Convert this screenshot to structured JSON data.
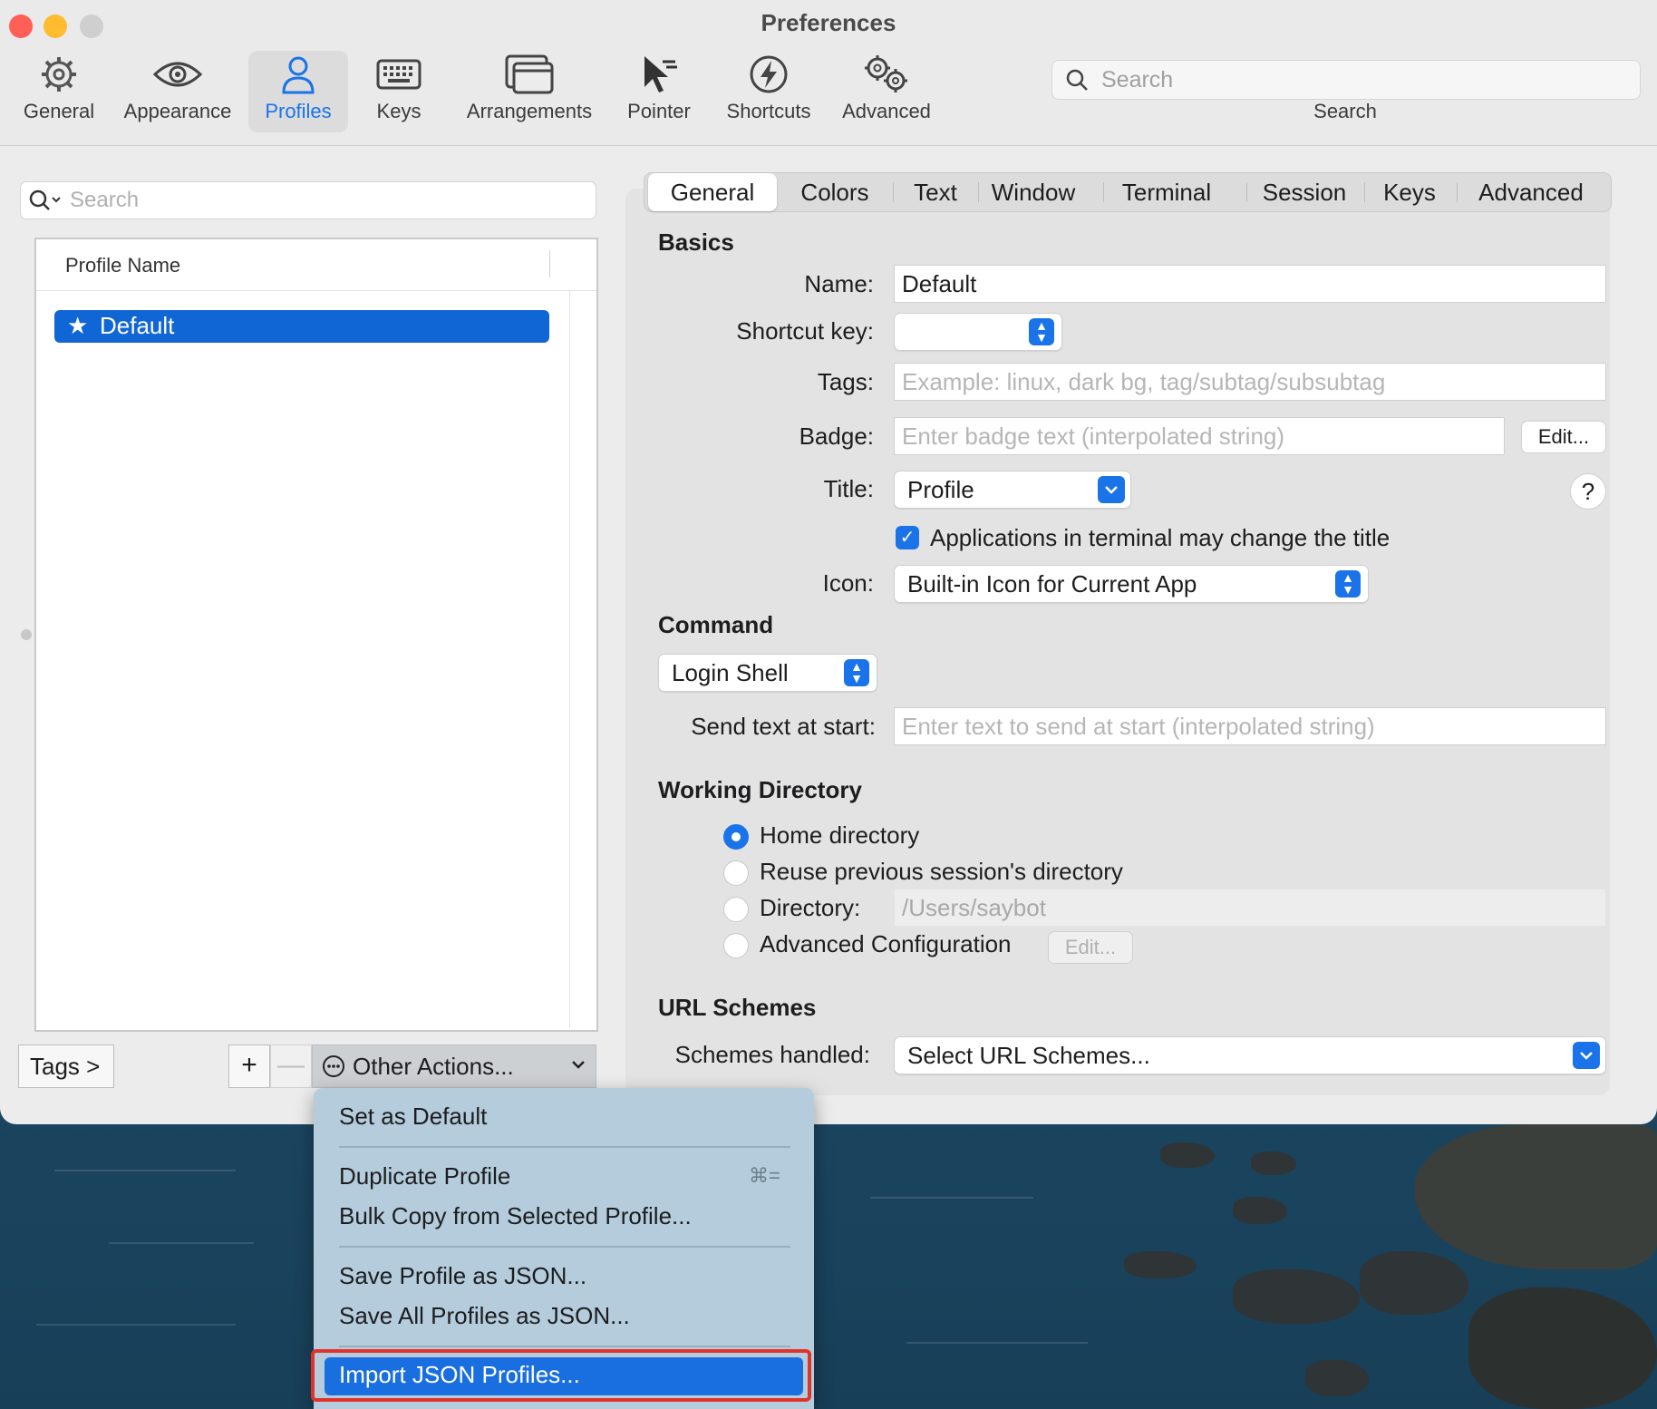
{
  "window": {
    "title": "Preferences"
  },
  "toolbar": {
    "items": [
      {
        "label": "General",
        "icon": "gear-icon"
      },
      {
        "label": "Appearance",
        "icon": "eye-icon"
      },
      {
        "label": "Profiles",
        "icon": "person-icon"
      },
      {
        "label": "Keys",
        "icon": "keyboard-icon"
      },
      {
        "label": "Arrangements",
        "icon": "windows-icon"
      },
      {
        "label": "Pointer",
        "icon": "cursor-icon"
      },
      {
        "label": "Shortcuts",
        "icon": "lightning-icon"
      },
      {
        "label": "Advanced",
        "icon": "gears-icon"
      }
    ],
    "active": "Profiles",
    "search_placeholder": "Search",
    "search_caption": "Search"
  },
  "profiles": {
    "search_placeholder": "Search",
    "column_header": "Profile Name",
    "rows": [
      {
        "name": "Default",
        "is_default": true,
        "selected": true
      }
    ],
    "tags_button": "Tags >",
    "add_button": "+",
    "remove_button": "—",
    "other_actions": "Other Actions..."
  },
  "tabs": {
    "items": [
      "General",
      "Colors",
      "Text",
      "Window",
      "Terminal",
      "Session",
      "Keys",
      "Advanced"
    ],
    "active": "General"
  },
  "basics": {
    "section": "Basics",
    "name_label": "Name:",
    "name_value": "Default",
    "shortcut_label": "Shortcut key:",
    "tags_label": "Tags:",
    "tags_placeholder": "Example: linux, dark bg, tag/subtag/subsubtag",
    "badge_label": "Badge:",
    "badge_placeholder": "Enter badge text (interpolated string)",
    "badge_edit": "Edit...",
    "title_label": "Title:",
    "title_value": "Profile",
    "help": "?",
    "apps_change_title": "Applications in terminal may change the title",
    "icon_label": "Icon:",
    "icon_value": "Built-in Icon for Current App"
  },
  "command": {
    "section": "Command",
    "mode": "Login Shell",
    "send_text_label": "Send text at start:",
    "send_text_placeholder": "Enter text to send at start (interpolated string)"
  },
  "working_directory": {
    "section": "Working Directory",
    "options": [
      "Home directory",
      "Reuse previous session's directory",
      "Directory:",
      "Advanced Configuration"
    ],
    "selected": "Home directory",
    "directory_placeholder": "/Users/saybot",
    "advanced_edit": "Edit..."
  },
  "url_schemes": {
    "section": "URL Schemes",
    "label": "Schemes handled:",
    "value": "Select URL Schemes..."
  },
  "menu": {
    "items": [
      {
        "label": "Set as Default"
      },
      {
        "label": "Duplicate Profile",
        "shortcut": "⌘="
      },
      {
        "label": "Bulk Copy from Selected Profile..."
      },
      {
        "label": "Save Profile as JSON..."
      },
      {
        "label": "Save All Profiles as JSON..."
      },
      {
        "label": "Import JSON Profiles..."
      }
    ],
    "highlighted": "Import JSON Profiles..."
  },
  "colors": {
    "accent": "#1a73e8",
    "highlight_border": "#e0342b"
  }
}
